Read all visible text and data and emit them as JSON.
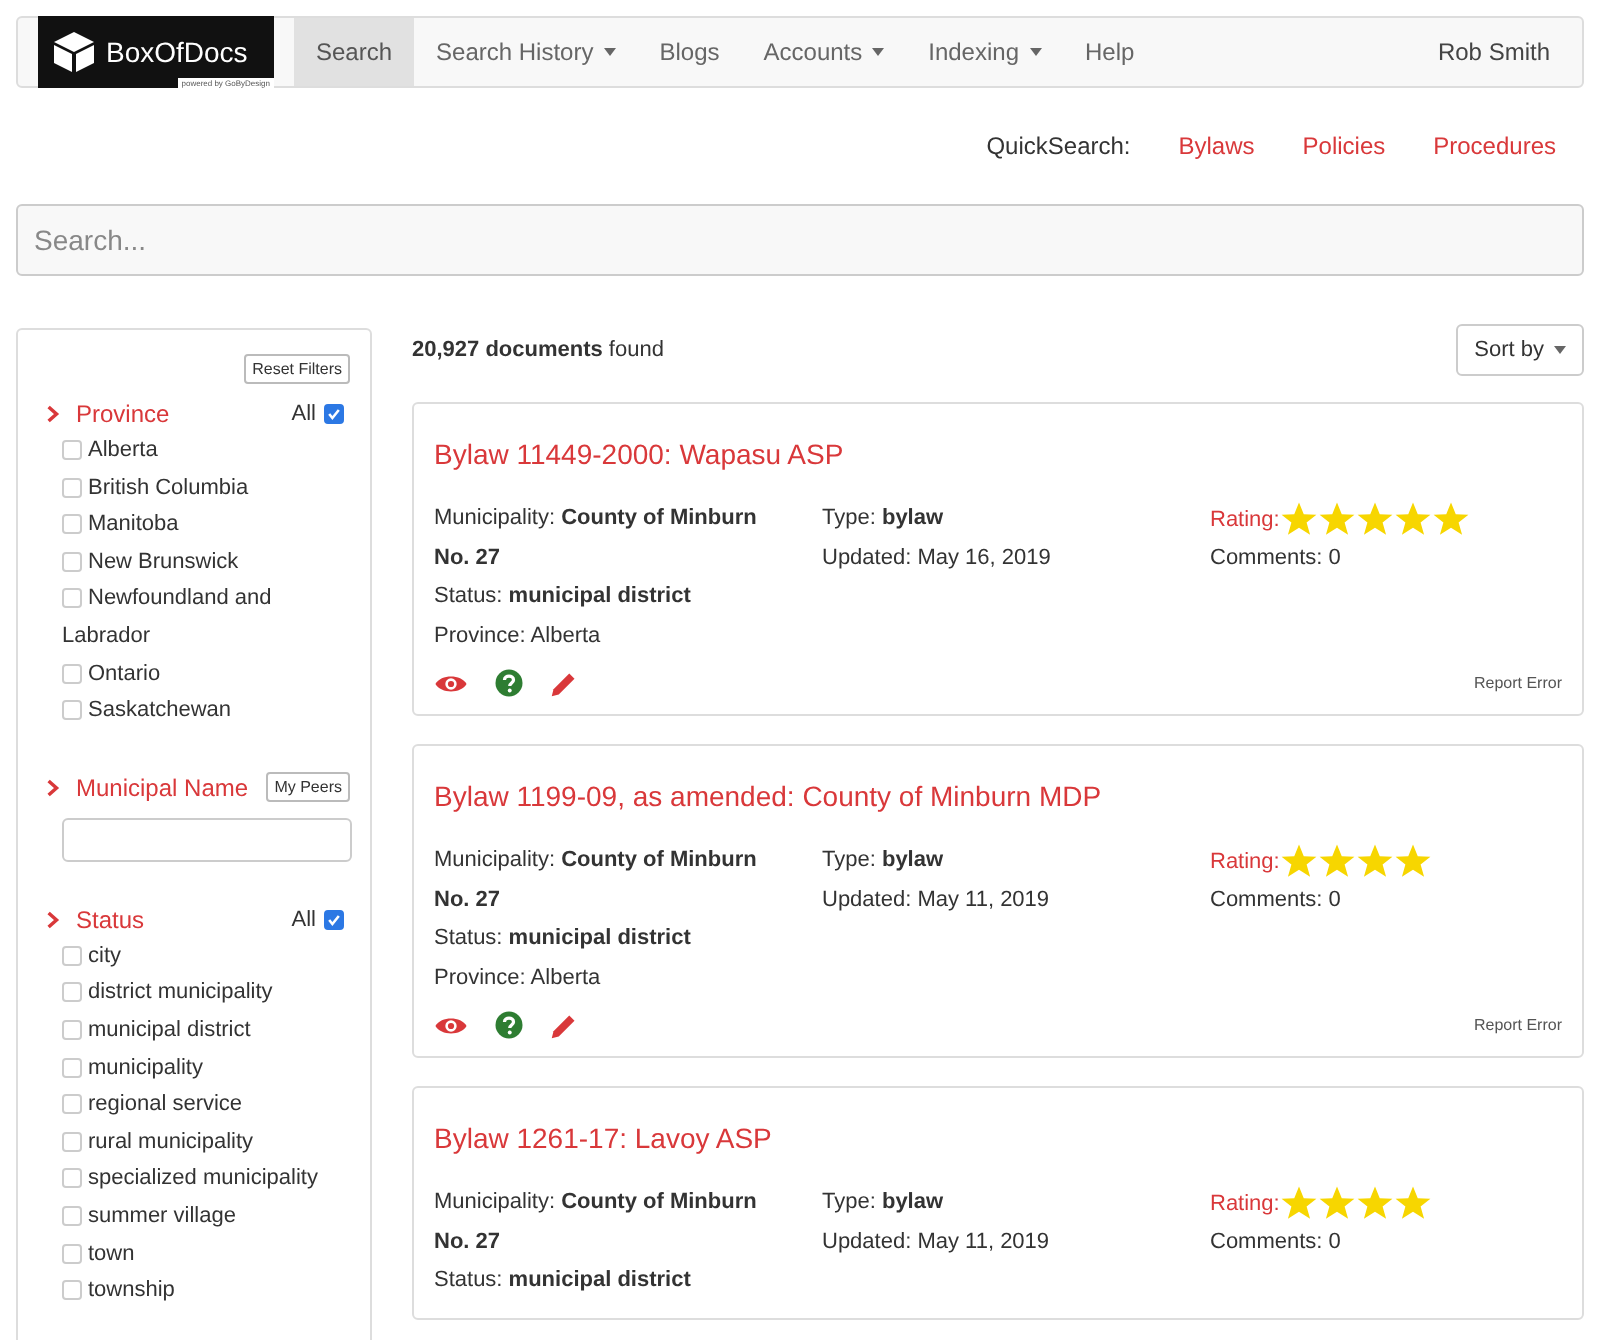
{
  "navbar": {
    "logo": {
      "name": "BoxOfDocs",
      "tagline": "powered by GoByDesign"
    },
    "items": [
      {
        "label": "Search",
        "selected": true,
        "dropdown": false
      },
      {
        "label": "Search History",
        "selected": false,
        "dropdown": true
      },
      {
        "label": "Blogs",
        "selected": false,
        "dropdown": false
      },
      {
        "label": "Accounts",
        "selected": false,
        "dropdown": true
      },
      {
        "label": "Indexing",
        "selected": false,
        "dropdown": true
      },
      {
        "label": "Help",
        "selected": false,
        "dropdown": false
      }
    ],
    "user": "Rob Smith"
  },
  "quick_search": {
    "label": "QuickSearch:",
    "links": [
      "Bylaws",
      "Policies",
      "Procedures"
    ]
  },
  "search": {
    "placeholder": "Search..."
  },
  "filters": {
    "reset_button": "Reset Filters",
    "sections": [
      {
        "kind": "checklist",
        "title": "Province",
        "all_label": "All",
        "all_checked": true,
        "options": [
          {
            "label": "Alberta",
            "checked": false
          },
          {
            "label": "British Columbia",
            "checked": false
          },
          {
            "label": "Manitoba",
            "checked": false
          },
          {
            "label": "New Brunswick",
            "checked": false
          },
          {
            "label": "Newfoundland and Labrador",
            "checked": false
          },
          {
            "label": "Ontario",
            "checked": false
          },
          {
            "label": "Saskatchewan",
            "checked": false
          }
        ]
      },
      {
        "kind": "text",
        "title": "Municipal Name",
        "button": "My Peers"
      },
      {
        "kind": "checklist",
        "title": "Status",
        "all_label": "All",
        "all_checked": true,
        "options": [
          {
            "label": "city",
            "checked": false
          },
          {
            "label": "district municipality",
            "checked": false
          },
          {
            "label": "municipal district",
            "checked": false
          },
          {
            "label": "municipality",
            "checked": false
          },
          {
            "label": "regional service",
            "checked": false
          },
          {
            "label": "rural municipality",
            "checked": false
          },
          {
            "label": "specialized municipality",
            "checked": false
          },
          {
            "label": "summer village",
            "checked": false
          },
          {
            "label": "town",
            "checked": false
          },
          {
            "label": "township",
            "checked": false
          }
        ]
      }
    ]
  },
  "results": {
    "count": "**20,927 documents** found",
    "sort_button": "Sort by",
    "documents": [
      {
        "title": "Bylaw 11449-2000: Wapasu ASP",
        "municipality": "Municipality: **County of Minburn No. 27**",
        "status": "Status: **municipal district**",
        "province": "Province: Alberta",
        "type": "Type: **bylaw**",
        "updated": "Updated: May 16, 2019",
        "rating_label": "Rating:",
        "stars": 5,
        "comments": "Comments: 0",
        "report": "Report Error"
      },
      {
        "title": "Bylaw 1199-09, as amended: County of Minburn MDP",
        "municipality": "Municipality: **County of Minburn No. 27**",
        "status": "Status: **municipal district**",
        "province": "Province: Alberta",
        "type": "Type: **bylaw**",
        "updated": "Updated: May 11, 2019",
        "rating_label": "Rating:",
        "stars": 4,
        "comments": "Comments: 0",
        "report": "Report Error"
      },
      {
        "title": "Bylaw 1261-17: Lavoy ASP",
        "municipality": "Municipality: **County of Minburn No. 27**",
        "status": "Status: **municipal district**",
        "type": "Type: **bylaw**",
        "updated": "Updated: May 11, 2019",
        "rating_label": "Rating:",
        "stars": 4,
        "comments": "Comments: 0"
      }
    ]
  }
}
